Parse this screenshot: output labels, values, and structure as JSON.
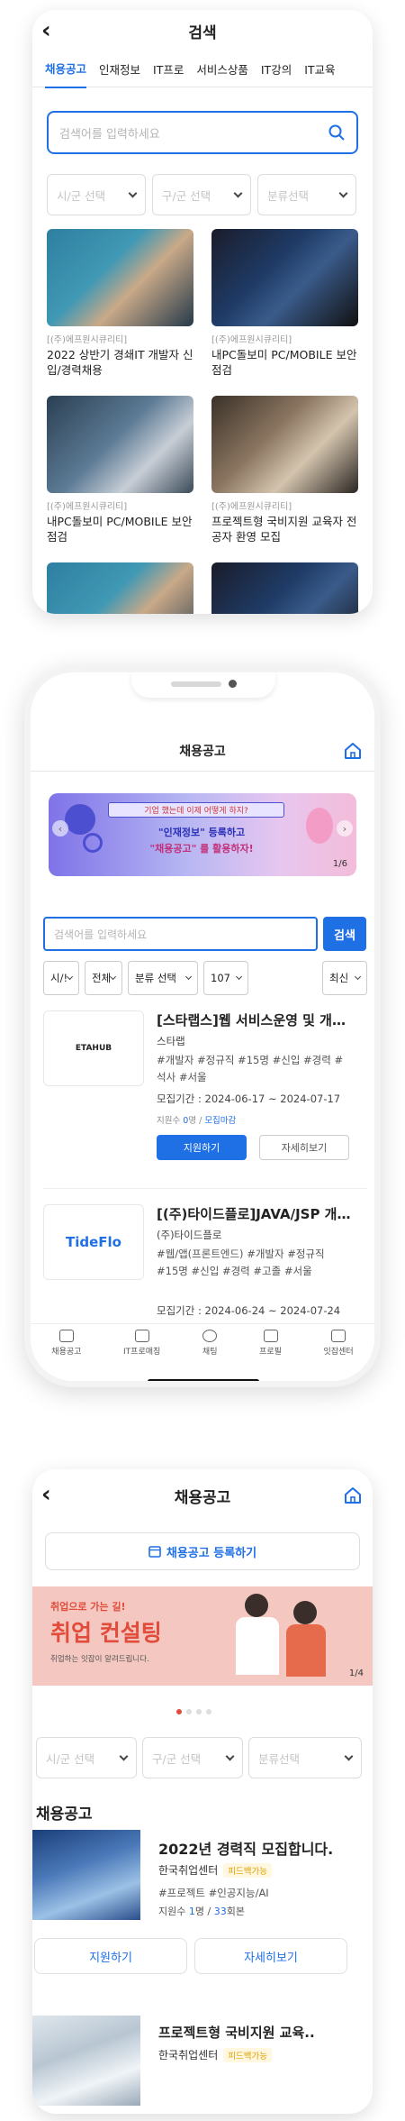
{
  "screen1": {
    "title": "검색",
    "tabs": [
      "채용공고",
      "인재정보",
      "IT프로",
      "서비스상품",
      "IT강의",
      "IT교육"
    ],
    "search_placeholder": "검색어를 입력하세요",
    "selects": [
      "시/군 선택",
      "구/군 선택",
      "분류선택"
    ],
    "cards": [
      {
        "company": "[(주)에프원시큐리티]",
        "title": "2022 상반기 경쇄IT 개발자 신입/경력채용"
      },
      {
        "company": "[(주)에프원시큐리티]",
        "title": "내PC돌보미 PC/MOBILE 보안점검"
      },
      {
        "company": "[(주)에프원시큐리티]",
        "title": "내PC돌보미 PC/MOBILE 보안점검"
      },
      {
        "company": "[(주)에프원시큐리티]",
        "title": "프로젝트형 국비지원 교육자 전공자 환영 모집"
      }
    ]
  },
  "screen2": {
    "title": "채용공고",
    "banner": {
      "line1": "기업 했는데 이제 어떻게 하지?",
      "line2": "\"인재정보\" 등록하고",
      "line3": "\"채용공고\" 를 활용하자!",
      "page": "1/6"
    },
    "search_placeholder": "검색어를 입력하세요",
    "search_button": "검색",
    "filters": [
      "시/!",
      "전체",
      "분류 선택",
      "107",
      "최신"
    ],
    "jobs": [
      {
        "logo": "ETAHUB",
        "title": "[스타랩스]웹 서비스운영 및 개발자",
        "company": "스타랩",
        "tags": "#개발자 #정규직 #15명 #신입 #경력 #석사 #서울",
        "period": "모집기간 : 2024-06-17 ~ 2024-07-17",
        "applicants_label": "지원수",
        "applicants_count": "0",
        "applicants_unit": "명",
        "status": "모집마감",
        "apply": "지원하기",
        "detail": "자세히보기"
      },
      {
        "logo": "TideFlo",
        "title": "[(주)타이드플로]JAVA/JSP 개발자",
        "company": "(주)타이드플로",
        "tags": "#웹/앱(프론트엔드) #개발자 #정규직 #15명 #신입 #경력 #고졸 #서울",
        "period": "모집기간 : 2024-06-24 ~ 2024-07-24"
      }
    ],
    "nav": [
      "채용공고",
      "IT프로매칭",
      "채팅",
      "프로필",
      "잇잡센터"
    ]
  },
  "screen3": {
    "title": "채용공고",
    "register": "채용공고 등록하기",
    "banner": {
      "small": "취업으로 가는 길!",
      "big": "취업 컨설팅",
      "desc": "취업하는 잇잡이 알려드립니다.",
      "page": "1/4"
    },
    "selects": [
      "시/군 선택",
      "구/군 선택",
      "분류선택"
    ],
    "section": "채용공고",
    "job": {
      "title": "2022년 경력직 모집합니다.",
      "company": "한국취업센터",
      "badge": "피드백가능",
      "tags": "#프로젝트 #인공지능/AI",
      "applicants_label": "지원수",
      "applicants_count": "1",
      "applicants_unit": "명 /",
      "views": "33",
      "views_unit": "회본",
      "apply": "지원하기",
      "detail": "자세히보기"
    },
    "job2": {
      "title": "프로젝트형 국비지원 교육..",
      "company": "한국취업센터",
      "badge": "피드백가능"
    }
  },
  "colors": {
    "accent": "#1f6fe5",
    "badge": "#e0a000"
  }
}
